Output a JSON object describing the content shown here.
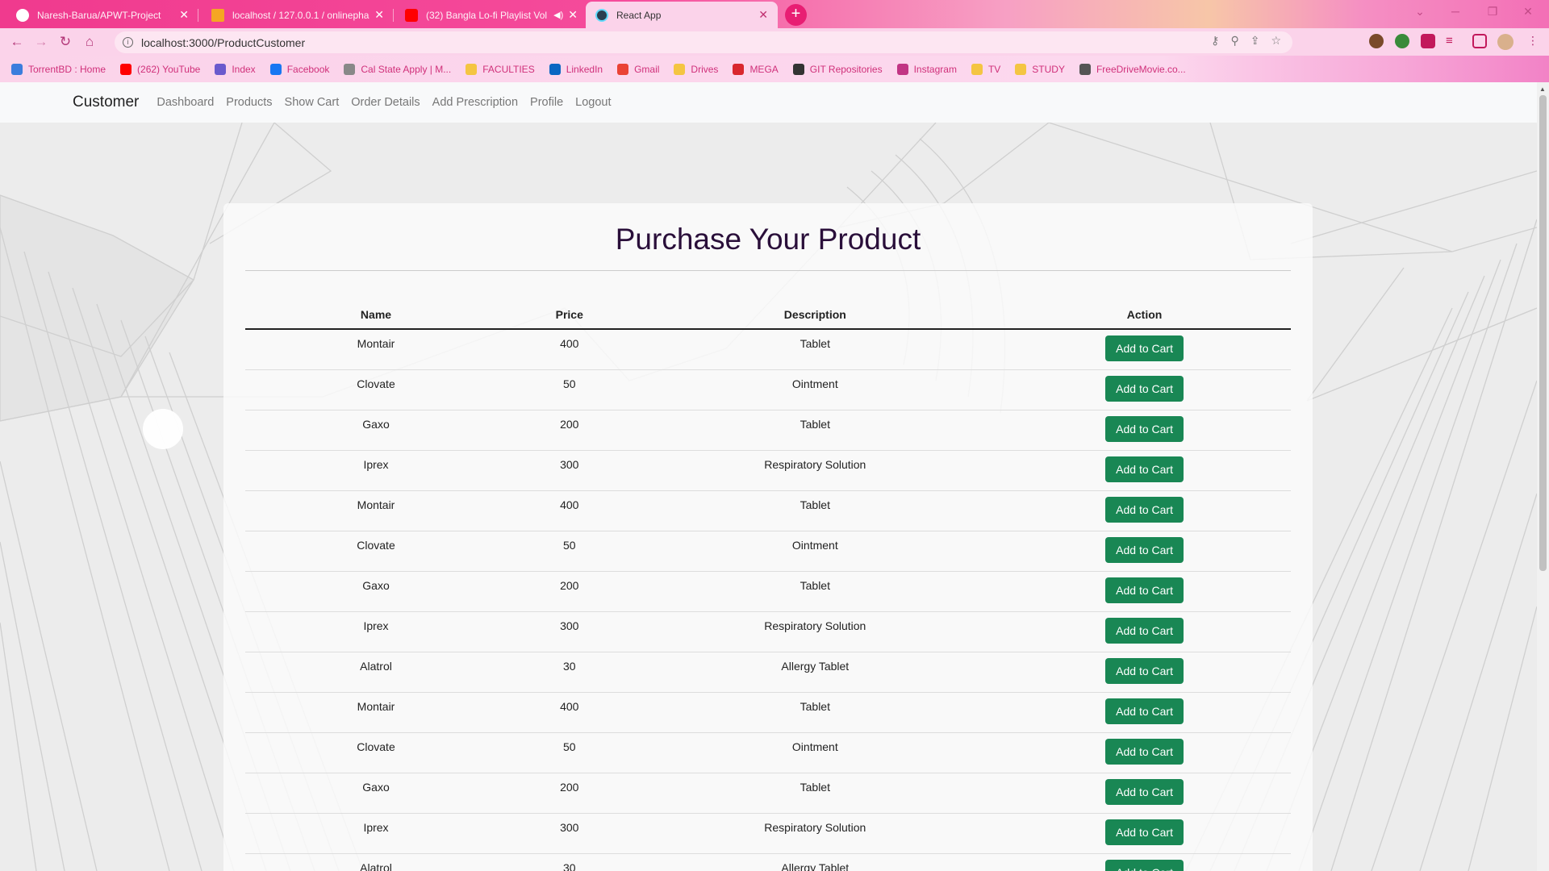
{
  "browser": {
    "tabs": [
      {
        "title": "Naresh-Barua/APWT-Project",
        "favicon_color": "#ffffff"
      },
      {
        "title": "localhost / 127.0.0.1 / onlinepha",
        "favicon_color": "#f5a623"
      },
      {
        "title": "(32) Bangla Lo-fi Playlist Vol",
        "favicon_color": "#ff0000"
      },
      {
        "title": "React App",
        "favicon_color": "#61dafb"
      }
    ],
    "address": "localhost:3000/ProductCustomer",
    "bookmarks": [
      {
        "label": "TorrentBD : Home",
        "color": "#3b7ddd"
      },
      {
        "label": "(262) YouTube",
        "color": "#ff0000"
      },
      {
        "label": "Index",
        "color": "#6a5acd"
      },
      {
        "label": "Facebook",
        "color": "#1877f2"
      },
      {
        "label": "Cal State Apply | M...",
        "color": "#888888"
      },
      {
        "label": "FACULTIES",
        "color": "#f4c542"
      },
      {
        "label": "LinkedIn",
        "color": "#0a66c2"
      },
      {
        "label": "Gmail",
        "color": "#ea4335"
      },
      {
        "label": "Drives",
        "color": "#f4c542"
      },
      {
        "label": "MEGA",
        "color": "#d9272e"
      },
      {
        "label": "GIT Repositories",
        "color": "#333333"
      },
      {
        "label": "Instagram",
        "color": "#c13584"
      },
      {
        "label": "TV",
        "color": "#f4c542"
      },
      {
        "label": "STUDY",
        "color": "#f4c542"
      },
      {
        "label": "FreeDriveMovie.co...",
        "color": "#555555"
      }
    ]
  },
  "navbar": {
    "brand": "Customer",
    "links": [
      "Dashboard",
      "Products",
      "Show Cart",
      "Order Details",
      "Add Prescription",
      "Profile",
      "Logout"
    ]
  },
  "page": {
    "title": "Purchase Your Product",
    "columns": [
      "Name",
      "Price",
      "Description",
      "Action"
    ],
    "action_label": "Add to Cart",
    "rows": [
      {
        "name": "Montair",
        "price": "400",
        "description": "Tablet"
      },
      {
        "name": "Clovate",
        "price": "50",
        "description": "Ointment"
      },
      {
        "name": "Gaxo",
        "price": "200",
        "description": "Tablet"
      },
      {
        "name": "Iprex",
        "price": "300",
        "description": "Respiratory Solution"
      },
      {
        "name": "Montair",
        "price": "400",
        "description": "Tablet"
      },
      {
        "name": "Clovate",
        "price": "50",
        "description": "Ointment"
      },
      {
        "name": "Gaxo",
        "price": "200",
        "description": "Tablet"
      },
      {
        "name": "Iprex",
        "price": "300",
        "description": "Respiratory Solution"
      },
      {
        "name": "Alatrol",
        "price": "30",
        "description": "Allergy Tablet"
      },
      {
        "name": "Montair",
        "price": "400",
        "description": "Tablet"
      },
      {
        "name": "Clovate",
        "price": "50",
        "description": "Ointment"
      },
      {
        "name": "Gaxo",
        "price": "200",
        "description": "Tablet"
      },
      {
        "name": "Iprex",
        "price": "300",
        "description": "Respiratory Solution"
      },
      {
        "name": "Alatrol",
        "price": "30",
        "description": "Allergy Tablet"
      }
    ]
  },
  "colors": {
    "accent_button": "#198754",
    "title": "#2a0f3a"
  }
}
